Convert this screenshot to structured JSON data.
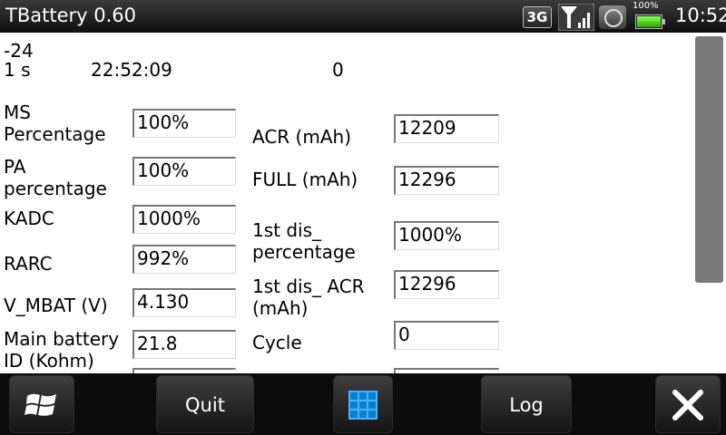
{
  "statusbar": {
    "title": "TBattery 0.60",
    "network": "3G",
    "battery_percent": "100%",
    "battery_level": 1.0,
    "time": "10:52",
    "icons": [
      "signal-icon",
      "volume-icon",
      "battery-icon"
    ]
  },
  "content": {
    "line1": "-24",
    "line2_left": "1 s",
    "line2_mid": "22:52:09",
    "line2_right": "0",
    "left_fields": [
      {
        "label": "MS Percentage",
        "value": "100%"
      },
      {
        "label": "PA percentage",
        "value": "100%"
      },
      {
        "label": "KADC",
        "value": "1000%"
      },
      {
        "label": "RARC",
        "value": "992%"
      },
      {
        "label": "V_MBAT (V)",
        "value": "4.130"
      },
      {
        "label": "Main battery ID (Kohm)",
        "value": "21.8"
      }
    ],
    "right_fields": [
      {
        "label": "ACR (mAh)",
        "value": "12209"
      },
      {
        "label": "FULL (mAh)",
        "value": "12296"
      },
      {
        "label": "1st dis_ percentage",
        "value": "1000%"
      },
      {
        "label": "1st dis_ ACR (mAh)",
        "value": "12296"
      },
      {
        "label": "Cycle",
        "value": "0"
      }
    ]
  },
  "softkeys": {
    "start_icon": "windows-logo-icon",
    "quit": "Quit",
    "keyboard_icon": "grid-icon",
    "log": "Log",
    "close_icon": "close-icon"
  }
}
